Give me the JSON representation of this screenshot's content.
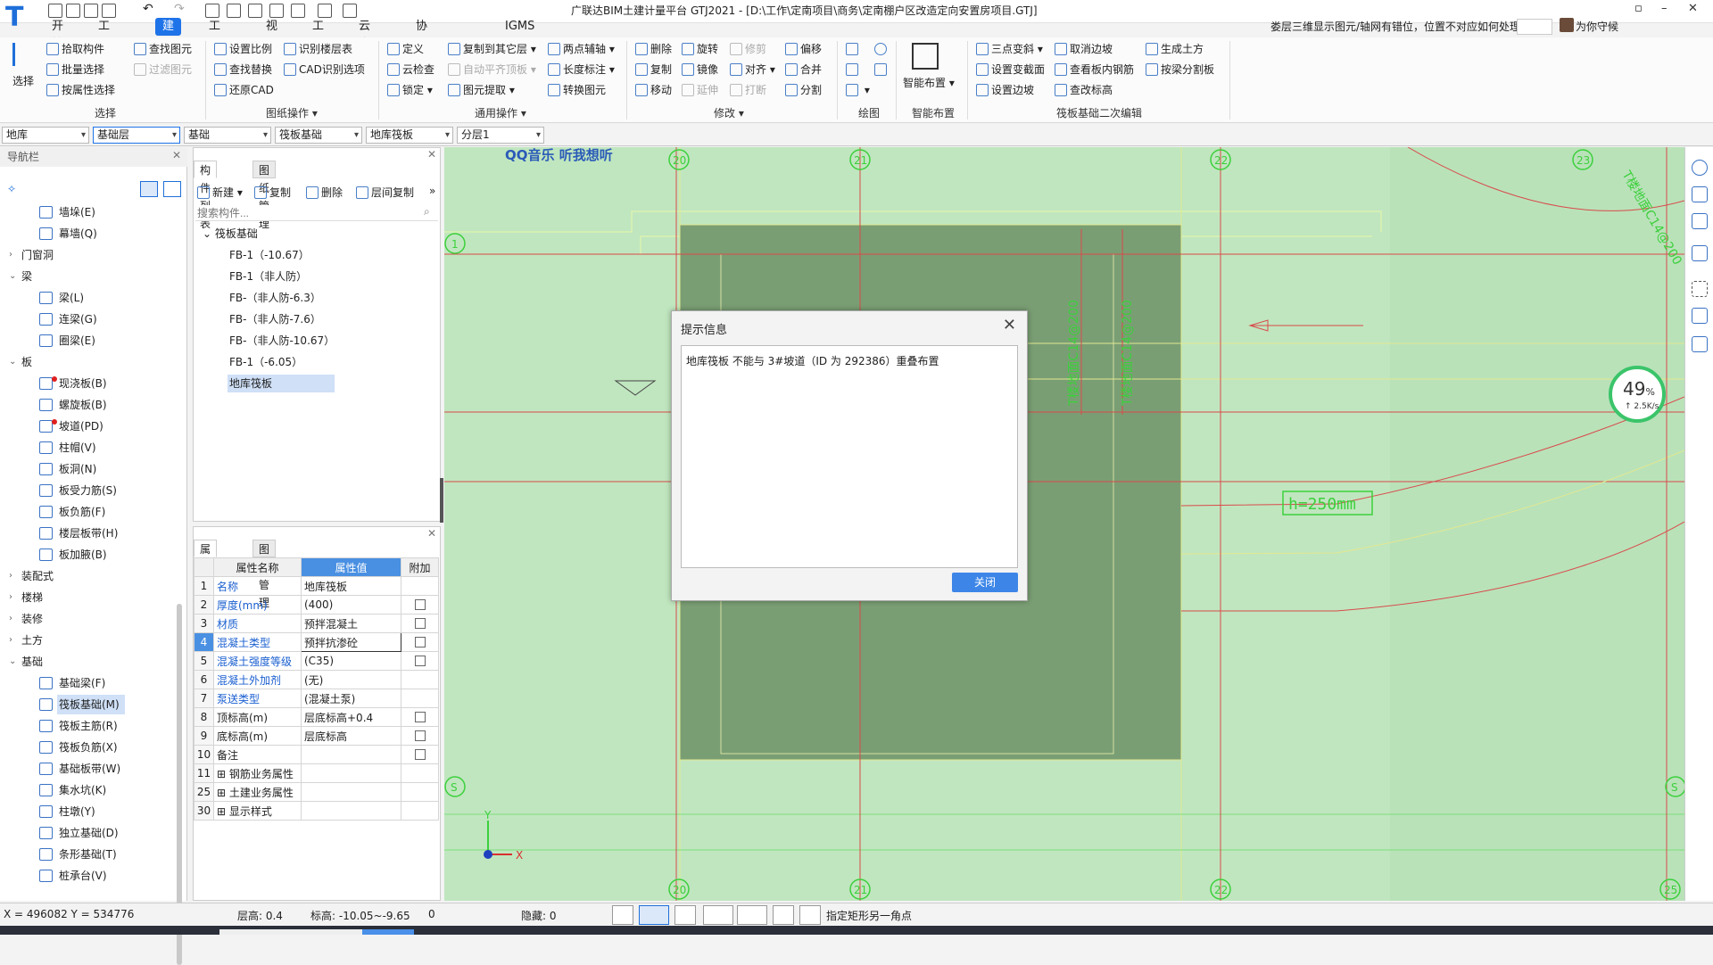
{
  "window": {
    "title": "广联达BIM土建计量平台 GTJ2021 - [D:\\工作\\定南项目\\商务\\定南棚户区改造定向安置房项目.GTJ]"
  },
  "menu": [
    "开始",
    "工程设置",
    "建模",
    "工程量",
    "视图",
    "工具",
    "云应用",
    "协同建模(限免)",
    "IGMS"
  ],
  "header": {
    "question": "娄层三维显示图元/轴网有错位，位置不对应如何处理?",
    "user": "为你守候"
  },
  "ribbon": {
    "select": {
      "big": "选择",
      "items": [
        "拾取构件",
        "批量选择",
        "按属性选择",
        "查找图元",
        "过滤图元"
      ],
      "group": "选择"
    },
    "drawing": {
      "items": [
        "设置比例",
        "识别楼层表",
        "查找替换",
        "CAD识别选项",
        "还原CAD"
      ],
      "group": "图纸操作"
    },
    "common": {
      "items": [
        "定义",
        "复制到其它层",
        "两点辅轴",
        "云检查",
        "自动平齐顶板",
        "长度标注",
        "锁定",
        "图元提取",
        "转换图元"
      ],
      "group": "通用操作"
    },
    "modify": {
      "items": [
        "删除",
        "旋转",
        "修剪",
        "偏移",
        "复制",
        "镜像",
        "对齐",
        "合并",
        "移动",
        "延伸",
        "打断",
        "分割"
      ],
      "group": "修改"
    },
    "draw": {
      "group": "绘图"
    },
    "smart": {
      "big": "智能布置",
      "group": "智能布置"
    },
    "raft": {
      "items": [
        "三点变斜",
        "取消边坡",
        "生成土方",
        "设置变截面",
        "查看板内钢筋",
        "按梁分割板",
        "设置边坡",
        "查改标高"
      ],
      "group": "筏板基础二次编辑"
    }
  },
  "filters": [
    "地库",
    "基础层",
    "基础",
    "筏板基础",
    "地库筏板",
    "分层1"
  ],
  "nav": {
    "title": "导航栏",
    "items": [
      {
        "label": "墙垛(E)",
        "level": 2
      },
      {
        "label": "幕墙(Q)",
        "level": 2
      },
      {
        "label": "门窗洞",
        "level": 1,
        "arrow": "›"
      },
      {
        "label": "梁",
        "level": 1,
        "arrow": "⌄"
      },
      {
        "label": "梁(L)",
        "level": 2
      },
      {
        "label": "连梁(G)",
        "level": 2
      },
      {
        "label": "圈梁(E)",
        "level": 2
      },
      {
        "label": "板",
        "level": 1,
        "arrow": "⌄"
      },
      {
        "label": "现浇板(B)",
        "level": 2,
        "dot": true
      },
      {
        "label": "螺旋板(B)",
        "level": 2
      },
      {
        "label": "坡道(PD)",
        "level": 2,
        "dot": true
      },
      {
        "label": "柱帽(V)",
        "level": 2
      },
      {
        "label": "板洞(N)",
        "level": 2
      },
      {
        "label": "板受力筋(S)",
        "level": 2
      },
      {
        "label": "板负筋(F)",
        "level": 2
      },
      {
        "label": "楼层板带(H)",
        "level": 2
      },
      {
        "label": "板加腋(B)",
        "level": 2
      },
      {
        "label": "装配式",
        "level": 1,
        "arrow": "›"
      },
      {
        "label": "楼梯",
        "level": 1,
        "arrow": "›"
      },
      {
        "label": "装修",
        "level": 1,
        "arrow": "›"
      },
      {
        "label": "土方",
        "level": 1,
        "arrow": "›"
      },
      {
        "label": "基础",
        "level": 1,
        "arrow": "⌄"
      },
      {
        "label": "基础梁(F)",
        "level": 2
      },
      {
        "label": "筏板基础(M)",
        "level": 2,
        "selected": true
      },
      {
        "label": "筏板主筋(R)",
        "level": 2
      },
      {
        "label": "筏板负筋(X)",
        "level": 2
      },
      {
        "label": "基础板带(W)",
        "level": 2
      },
      {
        "label": "集水坑(K)",
        "level": 2
      },
      {
        "label": "柱墩(Y)",
        "level": 2
      },
      {
        "label": "独立基础(D)",
        "level": 2
      },
      {
        "label": "条形基础(T)",
        "level": 2
      },
      {
        "label": "桩承台(V)",
        "level": 2
      }
    ]
  },
  "components": {
    "tabs": [
      "构件列表",
      "图纸管理"
    ],
    "tools": [
      "新建",
      "复制",
      "删除",
      "层间复制"
    ],
    "search_placeholder": "搜索构件...",
    "group": "筏板基础",
    "items": [
      "FB-1（-10.67）",
      "FB-1（非人防）",
      "FB-（非人防-6.3）",
      "FB-（非人防-7.6）",
      "FB-（非人防-10.67）",
      "FB-1（-6.05）",
      "地库筏板"
    ]
  },
  "properties": {
    "tabs": [
      "属性列表",
      "图层管理"
    ],
    "headers": [
      "属性名称",
      "属性值",
      "附加"
    ],
    "rows": [
      {
        "n": "1",
        "name": "名称",
        "value": "地库筏板",
        "link": true,
        "cb": false
      },
      {
        "n": "2",
        "name": "厚度(mm)",
        "value": "(400)",
        "link": true,
        "cb": true
      },
      {
        "n": "3",
        "name": "材质",
        "value": "预拌混凝土",
        "link": true,
        "cb": true
      },
      {
        "n": "4",
        "name": "混凝土类型",
        "value": "预拌抗渗砼",
        "link": true,
        "cb": true,
        "hl": true
      },
      {
        "n": "5",
        "name": "混凝土强度等级",
        "value": "(C35)",
        "link": true,
        "cb": true
      },
      {
        "n": "6",
        "name": "混凝土外加剂",
        "value": "(无)",
        "link": true,
        "cb": false
      },
      {
        "n": "7",
        "name": "泵送类型",
        "value": "(混凝土泵)",
        "link": true,
        "cb": false
      },
      {
        "n": "8",
        "name": "顶标高(m)",
        "value": "层底标高+0.4",
        "link": false,
        "cb": true
      },
      {
        "n": "9",
        "name": "底标高(m)",
        "value": "层底标高",
        "link": false,
        "cb": true
      },
      {
        "n": "10",
        "name": "备注",
        "value": "",
        "link": false,
        "cb": true
      },
      {
        "n": "11",
        "name": "钢筋业务属性",
        "value": "",
        "link": false,
        "cb": false,
        "expand": true
      },
      {
        "n": "25",
        "name": "土建业务属性",
        "value": "",
        "link": false,
        "cb": false,
        "expand": true
      },
      {
        "n": "30",
        "name": "显示样式",
        "value": "",
        "link": false,
        "cb": false,
        "expand": true
      }
    ]
  },
  "canvas": {
    "watermark": "QQ音乐 听我想听",
    "axis_top": [
      "20",
      "21",
      "22",
      "23"
    ],
    "axis_bottom": [
      "20",
      "21",
      "22",
      "25"
    ],
    "axis_left": [
      "1",
      "S"
    ],
    "axis_right": [
      "S"
    ],
    "annotation": "h=250mm",
    "vtext1": "T楼地面C14@200",
    "vtext2": "T楼地面C14@200",
    "vtext3": "T楼地面C14@200",
    "axis_x": "X",
    "axis_y": "Y"
  },
  "dialog": {
    "title": "提示信息",
    "message": "地库筏板 不能与 3#坡道（ID 为 292386）重叠布置",
    "button": "关闭"
  },
  "progress": {
    "percent": "49",
    "unit": "%",
    "speed": "↑ 2.5K/s"
  },
  "status": {
    "coords": "X = 496082 Y = 534776",
    "floor_height": "层高:  0.4",
    "elevation": "标高:  -10.05~-9.65",
    "zero": "0",
    "hidden": "隐藏:  0",
    "hint": "指定矩形另一角点"
  }
}
